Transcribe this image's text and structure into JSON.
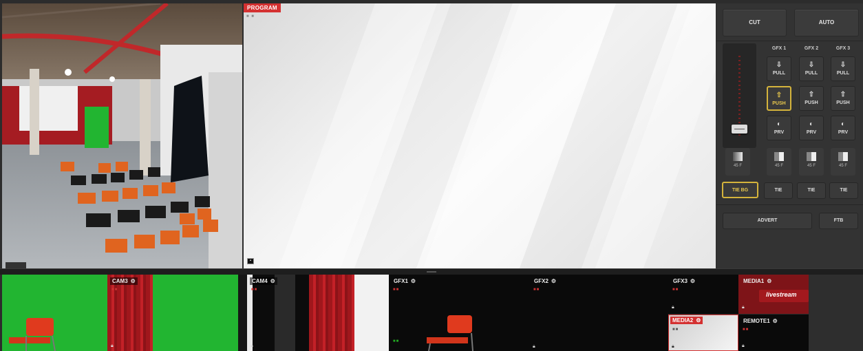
{
  "preview": {},
  "program": {
    "label": "PROGRAM",
    "dots": "■ ■"
  },
  "controls": {
    "cut_label": "CUT",
    "auto_label": "AUTO",
    "gfx_headers": [
      "GFX 1",
      "GFX 2",
      "GFX 3"
    ],
    "pull_label": "PULL",
    "push_label": "PUSH",
    "prv_label": "PRV",
    "duration_label": "45 F",
    "tie_bg_label": "TIE BG",
    "tie_label": "TIE",
    "advert_label": "ADVERT",
    "ftb_label": "FTB"
  },
  "sources": [
    {
      "name": "CAM3"
    },
    {
      "name": "CAM4"
    },
    {
      "name": "GFX1"
    },
    {
      "name": "GFX2"
    },
    {
      "name": "GFX3"
    },
    {
      "name": "MEDIA1",
      "overlay_text": "livestream"
    },
    {
      "name": "MEDIA2"
    },
    {
      "name": "REMOTE1"
    }
  ],
  "colors": {
    "program_red": "#d43131",
    "selected_gold": "#d5b43c",
    "chroma_green": "#22b531"
  },
  "icons": [
    "gear-icon",
    "lock-icon",
    "pull-icon",
    "push-icon",
    "preview-eye-icon",
    "transition-icon"
  ]
}
